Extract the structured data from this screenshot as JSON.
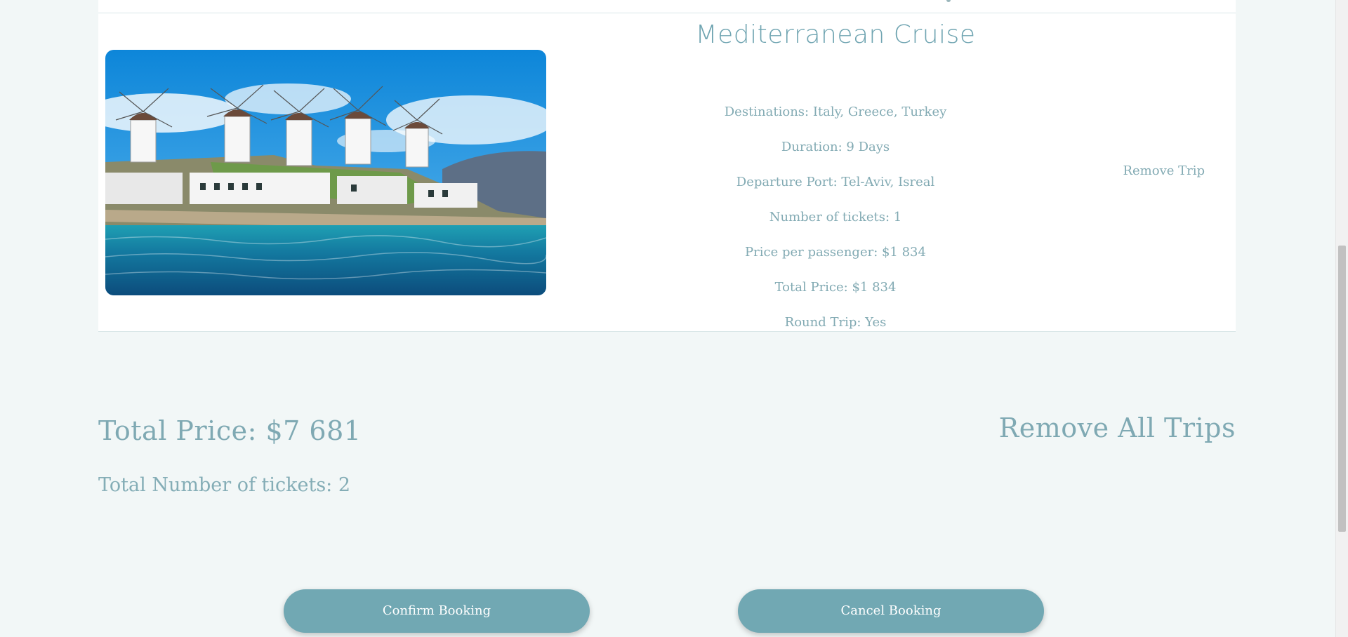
{
  "trip": {
    "title": "Mediterranean Cruise",
    "image_icon": "windmills-photo",
    "details": [
      "Destinations: Italy, Greece, Turkey",
      "Duration: 9 Days",
      "Departure Port: Tel-Aviv, Isreal",
      "Number of tickets: 1",
      "Price per passenger: $1 834",
      "Total Price: $1 834",
      "Round Trip: Yes"
    ],
    "remove_label": "Remove Trip"
  },
  "summary": {
    "total_price": "Total Price: $7 681",
    "total_tickets": "Total Number of tickets: 2",
    "remove_all_label": "Remove All Trips"
  },
  "actions": {
    "confirm_label": "Confirm Booking",
    "cancel_label": "Cancel Booking"
  },
  "colors": {
    "accent": "#71a8b3",
    "text": "#82aab3",
    "background": "#f2f7f7"
  }
}
